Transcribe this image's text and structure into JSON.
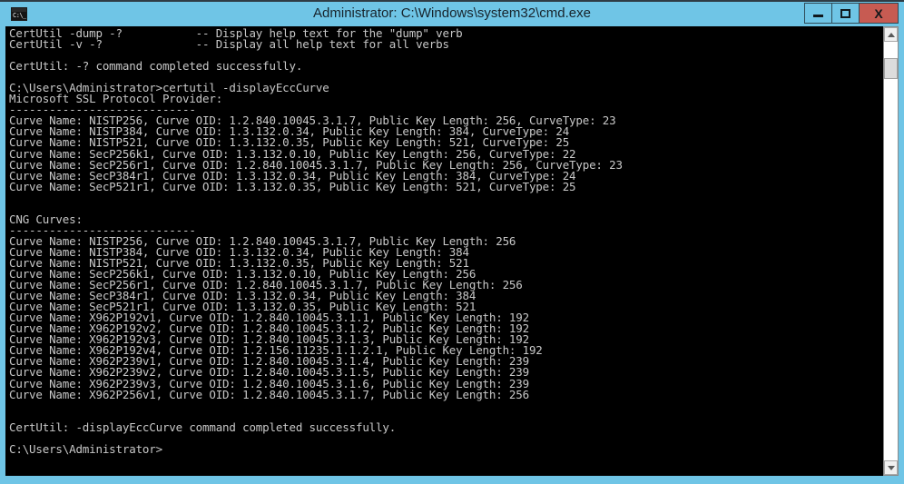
{
  "window": {
    "title": "Administrator: C:\\Windows\\system32\\cmd.exe",
    "icon_label": "C:\\_",
    "titlebar_color": "#6fc5e6",
    "console_bg": "#000000",
    "console_fg": "#c8c8c8",
    "close_button_color": "#c75b52"
  },
  "controls": {
    "minimize_label": "",
    "maximize_label": "",
    "close_label": "X"
  },
  "scrollbar": {
    "up_arrow_label": "",
    "down_arrow_label": "",
    "thumb_position_percent": 4
  },
  "console": {
    "lines": [
      "CertUtil -dump -?           -- Display help text for the \"dump\" verb",
      "CertUtil -v -?              -- Display all help text for all verbs",
      "",
      "CertUtil: -? command completed successfully.",
      "",
      "C:\\Users\\Administrator>certutil -displayEccCurve",
      "Microsoft SSL Protocol Provider:",
      "----------------------------",
      "Curve Name: NISTP256, Curve OID: 1.2.840.10045.3.1.7, Public Key Length: 256, CurveType: 23",
      "Curve Name: NISTP384, Curve OID: 1.3.132.0.34, Public Key Length: 384, CurveType: 24",
      "Curve Name: NISTP521, Curve OID: 1.3.132.0.35, Public Key Length: 521, CurveType: 25",
      "Curve Name: SecP256k1, Curve OID: 1.3.132.0.10, Public Key Length: 256, CurveType: 22",
      "Curve Name: SecP256r1, Curve OID: 1.2.840.10045.3.1.7, Public Key Length: 256, CurveType: 23",
      "Curve Name: SecP384r1, Curve OID: 1.3.132.0.34, Public Key Length: 384, CurveType: 24",
      "Curve Name: SecP521r1, Curve OID: 1.3.132.0.35, Public Key Length: 521, CurveType: 25",
      "",
      "",
      "CNG Curves:",
      "----------------------------",
      "Curve Name: NISTP256, Curve OID: 1.2.840.10045.3.1.7, Public Key Length: 256",
      "Curve Name: NISTP384, Curve OID: 1.3.132.0.34, Public Key Length: 384",
      "Curve Name: NISTP521, Curve OID: 1.3.132.0.35, Public Key Length: 521",
      "Curve Name: SecP256k1, Curve OID: 1.3.132.0.10, Public Key Length: 256",
      "Curve Name: SecP256r1, Curve OID: 1.2.840.10045.3.1.7, Public Key Length: 256",
      "Curve Name: SecP384r1, Curve OID: 1.3.132.0.34, Public Key Length: 384",
      "Curve Name: SecP521r1, Curve OID: 1.3.132.0.35, Public Key Length: 521",
      "Curve Name: X962P192v1, Curve OID: 1.2.840.10045.3.1.1, Public Key Length: 192",
      "Curve Name: X962P192v2, Curve OID: 1.2.840.10045.3.1.2, Public Key Length: 192",
      "Curve Name: X962P192v3, Curve OID: 1.2.840.10045.3.1.3, Public Key Length: 192",
      "Curve Name: X962P192v4, Curve OID: 1.2.156.11235.1.1.2.1, Public Key Length: 192",
      "Curve Name: X962P239v1, Curve OID: 1.2.840.10045.3.1.4, Public Key Length: 239",
      "Curve Name: X962P239v2, Curve OID: 1.2.840.10045.3.1.5, Public Key Length: 239",
      "Curve Name: X962P239v3, Curve OID: 1.2.840.10045.3.1.6, Public Key Length: 239",
      "Curve Name: X962P256v1, Curve OID: 1.2.840.10045.3.1.7, Public Key Length: 256",
      "",
      "",
      "CertUtil: -displayEccCurve command completed successfully.",
      "",
      "C:\\Users\\Administrator>"
    ]
  }
}
